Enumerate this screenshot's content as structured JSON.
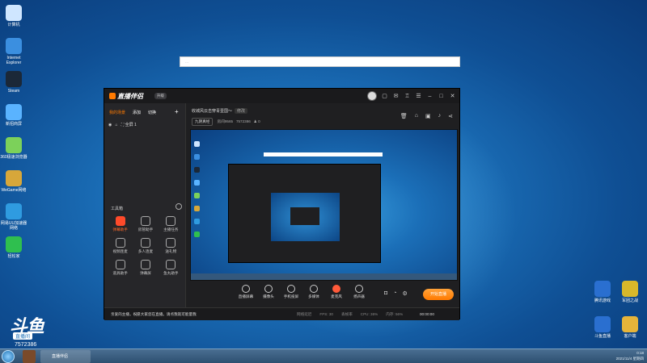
{
  "desktop": {
    "icons_left": [
      {
        "label": "计算机",
        "icon": "computer-icon",
        "color": "#cfe6ff"
      },
      {
        "label": "Internet Explorer",
        "icon": "ie-icon",
        "color": "#3b8fe0"
      },
      {
        "label": "Steam",
        "icon": "steam-icon",
        "color": "#1b2838"
      },
      {
        "label": "新招商屏",
        "icon": "app-icon",
        "color": "#5ab3ff"
      },
      {
        "label": "360极速浏览器",
        "icon": "browser-360-icon",
        "color": "#7cd15a"
      },
      {
        "label": "WeGame网络",
        "icon": "wegame-icon",
        "color": "#d7a73a"
      },
      {
        "label": "网易UU加速器网络",
        "icon": "uu-icon",
        "color": "#2f9be0"
      },
      {
        "label": "轻松家",
        "icon": "lock-icon",
        "color": "#2fbf4f"
      }
    ],
    "icons_right": [
      {
        "label": "腾讯游戏",
        "icon": "game-icon",
        "color": "#2a6fd0"
      },
      {
        "label": "军团之战",
        "icon": "game2-icon",
        "color": "#d8b82a"
      },
      {
        "label": "斗鱼直播",
        "icon": "douyu-icon",
        "color": "#2a6fd0"
      },
      {
        "label": "客户端",
        "icon": "folder-icon",
        "color": "#e6b43a"
      }
    ]
  },
  "app": {
    "logo": "直播伴侣",
    "version": "升级",
    "sidebar": {
      "tabs": [
        "我的场景",
        "添加",
        "切换"
      ],
      "scene": "全屏 1",
      "tools_label": "工具箱",
      "tools": [
        {
          "label": "弹幕助手",
          "hot": true
        },
        {
          "label": "房管助手",
          "hot": false
        },
        {
          "label": "主播任务",
          "hot": false
        },
        {
          "label": "视频连麦",
          "hot": false
        },
        {
          "label": "多人连麦",
          "hot": false
        },
        {
          "label": "送礼物",
          "hot": false
        },
        {
          "label": "道具助手",
          "hot": false
        },
        {
          "label": "弹幕屏",
          "hot": false
        },
        {
          "label": "鱼丸助手",
          "hot": false
        }
      ]
    },
    "stream": {
      "title": "收城风云击穿青壹国～",
      "badge": "修改",
      "category": "九阴真经",
      "room": "房间9565",
      "fans": "7572386",
      "viewers": "0"
    },
    "controls": [
      {
        "label": "直播屏幕",
        "red": false
      },
      {
        "label": "摄像头",
        "red": false
      },
      {
        "label": "手机投屏",
        "red": false
      },
      {
        "label": "多媒体",
        "red": false
      },
      {
        "label": "麦克风",
        "red": true
      },
      {
        "label": "扬声器",
        "red": false
      }
    ],
    "live_button": "开始直播",
    "status": {
      "notice": "亲爱的主播，祝愿大家您在直播。请点我就可能量我",
      "stats": [
        "网络延迟",
        "FPS: 30",
        "丢帧率",
        "CPU: 36%",
        "内存: 56%"
      ],
      "time": "00:00:00"
    }
  },
  "watermark": {
    "brand": "斗鱼",
    "sub": "直播间",
    "room_id": "7572386"
  },
  "taskbar": {
    "items": [
      {
        "label": "直播伴侣"
      }
    ],
    "time": "0:18",
    "date": "2021/11/4 星期四"
  }
}
